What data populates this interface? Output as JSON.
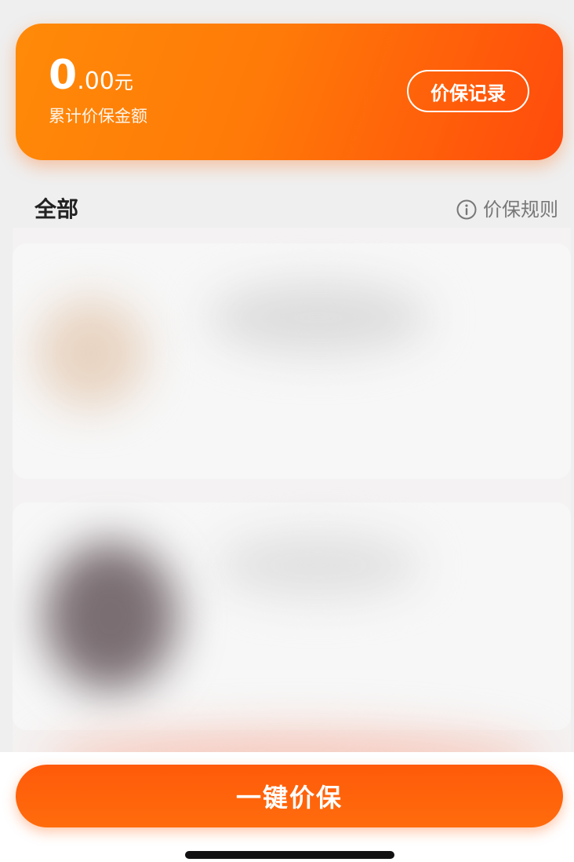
{
  "summary": {
    "amount_int": "0",
    "amount_dec": ".00",
    "amount_unit": "元",
    "amount_label": "累计价保金额",
    "record_button_label": "价保记录"
  },
  "section": {
    "title": "全部",
    "rules_label": "价保规则"
  },
  "footer": {
    "main_button_label": "一键价保"
  },
  "icons": {
    "rules": "info-icon"
  },
  "colors": {
    "accent_orange": "#ff7a08",
    "accent_red_orange": "#ff4a0c",
    "button_orange": "#ff5a0a",
    "background": "#efefef"
  }
}
